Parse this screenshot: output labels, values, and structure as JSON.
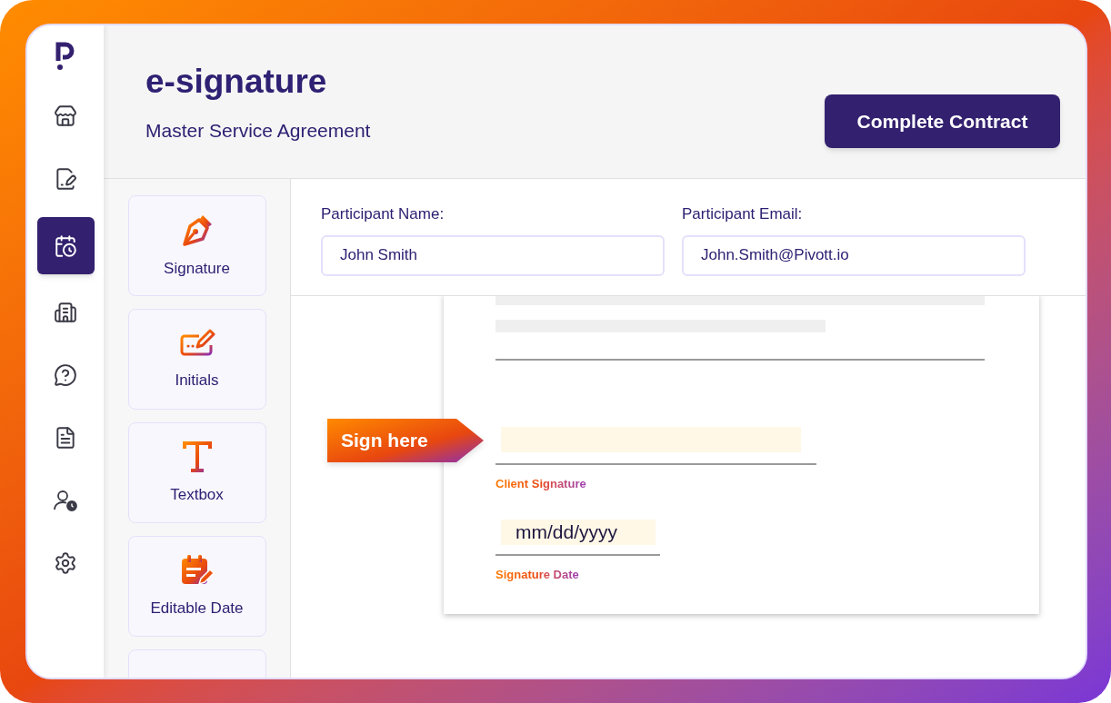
{
  "nav": [
    {
      "kind": "logo",
      "selected": false
    },
    {
      "kind": "store",
      "selected": false
    },
    {
      "kind": "signature",
      "selected": false
    },
    {
      "kind": "calendar",
      "selected": true
    },
    {
      "kind": "building",
      "selected": false
    },
    {
      "kind": "help",
      "selected": false
    },
    {
      "kind": "file",
      "selected": false
    },
    {
      "kind": "user-clock",
      "selected": false
    },
    {
      "kind": "settings",
      "selected": false
    }
  ],
  "header": {
    "title": "e-signature",
    "subtitle": "Master Service Agreement",
    "button": "Complete Contract"
  },
  "tools": [
    {
      "kind": "pen",
      "label": "Signature"
    },
    {
      "kind": "initials",
      "label": "Initials"
    },
    {
      "kind": "text",
      "label": "Textbox"
    },
    {
      "kind": "date",
      "label": "Editable Date"
    },
    {
      "kind": "cut"
    }
  ],
  "fields": [
    {
      "label": "Participant Name:",
      "value": "John Smith"
    },
    {
      "label": "Participant Email:",
      "value": "John.Smith@Pivott.io"
    }
  ],
  "document": {
    "tag": "Sign here",
    "signature_label": "Client Signature",
    "date_placeholder": "mm/dd/yyyy",
    "date_label": "Signature Date"
  }
}
